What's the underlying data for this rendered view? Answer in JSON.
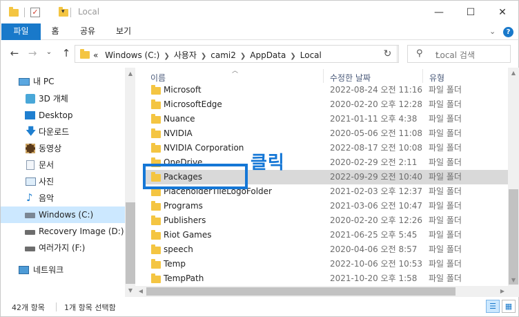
{
  "window": {
    "title": "Local",
    "minimize": "—",
    "maximize": "☐",
    "close": "✕"
  },
  "ribbon": {
    "tabs": [
      "파일",
      "홈",
      "공유",
      "보기"
    ],
    "expand": "⌄",
    "help": "?"
  },
  "nav": {
    "back": "←",
    "forward": "→",
    "recent": "⌄",
    "up": "↑",
    "overflow": "«",
    "breadcrumbs": [
      "Windows (C:)",
      "사용자",
      "cami2",
      "AppData",
      "Local"
    ],
    "refresh": "↻",
    "search_placeholder": "Local 검색"
  },
  "navpane": {
    "items": [
      {
        "label": "내 PC",
        "icon": "pc-icon",
        "level": 0
      },
      {
        "label": "3D 개체",
        "icon": "3d-objects-icon",
        "level": 1
      },
      {
        "label": "Desktop",
        "icon": "desktop-icon",
        "level": 1
      },
      {
        "label": "다운로드",
        "icon": "download-icon",
        "level": 1
      },
      {
        "label": "동영상",
        "icon": "video-icon",
        "level": 1
      },
      {
        "label": "문서",
        "icon": "document-icon",
        "level": 1
      },
      {
        "label": "사진",
        "icon": "picture-icon",
        "level": 1
      },
      {
        "label": "음악",
        "icon": "music-icon",
        "level": 1
      },
      {
        "label": "Windows (C:)",
        "icon": "drive-icon",
        "level": 1,
        "selected": true
      },
      {
        "label": "Recovery Image (D:)",
        "icon": "drive-icon",
        "level": 1
      },
      {
        "label": "여러가지 (F:)",
        "icon": "drive-icon",
        "level": 1
      },
      {
        "label": "네트워크",
        "icon": "network-icon",
        "level": 0
      }
    ]
  },
  "columns": {
    "name": "이름",
    "date": "수정한 날짜",
    "type": "유형"
  },
  "files": [
    {
      "name": "Microsoft",
      "date": "2022-08-24 오전 11:16",
      "type": "파일 폴더"
    },
    {
      "name": "MicrosoftEdge",
      "date": "2020-02-20 오후 12:28",
      "type": "파일 폴더"
    },
    {
      "name": "Nuance",
      "date": "2021-01-11 오후 4:38",
      "type": "파일 폴더"
    },
    {
      "name": "NVIDIA",
      "date": "2020-05-06 오전 11:08",
      "type": "파일 폴더"
    },
    {
      "name": "NVIDIA Corporation",
      "date": "2022-08-17 오전 10:08",
      "type": "파일 폴더"
    },
    {
      "name": "OneDrive",
      "date": "2020-02-29 오전 2:11",
      "type": "파일 폴더"
    },
    {
      "name": "Packages",
      "date": "2022-09-29 오전 10:40",
      "type": "파일 폴더",
      "selected": true
    },
    {
      "name": "PlaceholderTileLogoFolder",
      "date": "2021-02-03 오후 12:37",
      "type": "파일 폴더"
    },
    {
      "name": "Programs",
      "date": "2021-03-06 오전 10:47",
      "type": "파일 폴더"
    },
    {
      "name": "Publishers",
      "date": "2020-02-20 오후 12:26",
      "type": "파일 폴더"
    },
    {
      "name": "Riot Games",
      "date": "2021-06-25 오후 5:45",
      "type": "파일 폴더"
    },
    {
      "name": "speech",
      "date": "2020-04-06 오전 8:57",
      "type": "파일 폴더"
    },
    {
      "name": "Temp",
      "date": "2022-10-06 오전 10:53",
      "type": "파일 폴더"
    },
    {
      "name": "TempPath",
      "date": "2021-10-20 오후 1:58",
      "type": "파일 폴더"
    }
  ],
  "annotation": {
    "text": "클릭",
    "color": "#1577d6"
  },
  "status": {
    "count": "42개 항목",
    "selection": "1개 항목 선택함"
  },
  "colors": {
    "accent": "#1979ca",
    "folder": "#f4c542",
    "selected_nav": "#cce8ff",
    "selected_row": "#d9d9d9"
  }
}
